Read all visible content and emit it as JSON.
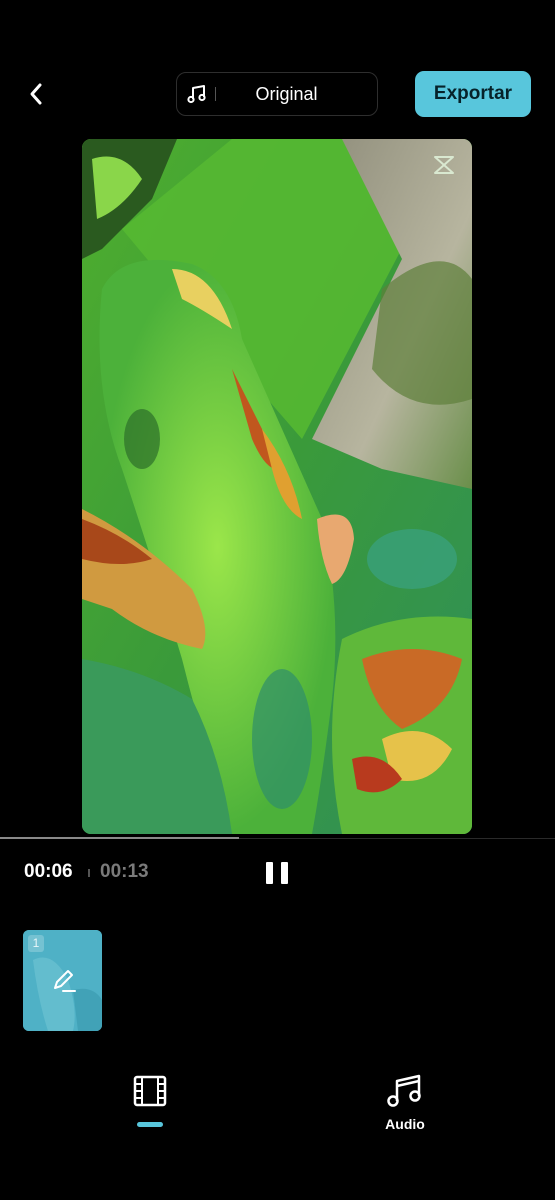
{
  "header": {
    "back_icon": "chevron-left-icon",
    "audio_option": {
      "icon": "music-note-icon",
      "label": "Original"
    },
    "export_label": "Exportar",
    "accent_color": "#58c6dc"
  },
  "preview": {
    "watermark_icon": "capcut-logo-icon"
  },
  "playback": {
    "current_time": "00:06",
    "total_time": "00:13",
    "progress_fraction": 0.43,
    "pause_icon": "pause-icon"
  },
  "clips": [
    {
      "number": "1",
      "edit_icon": "pencil-edit-icon"
    }
  ],
  "bottom_tabs": [
    {
      "icon": "film-strip-icon",
      "label": "",
      "active": true
    },
    {
      "icon": "music-notes-icon",
      "label": "Audio",
      "active": false
    }
  ]
}
